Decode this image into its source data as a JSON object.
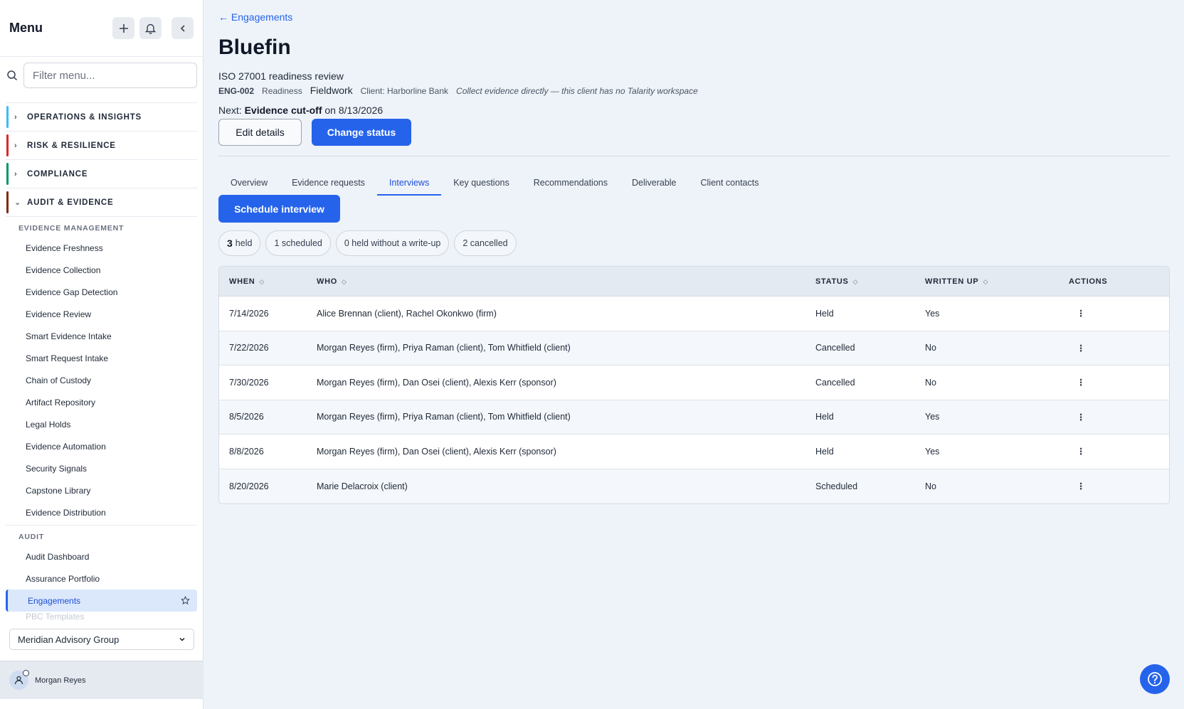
{
  "sidebar": {
    "title": "Menu",
    "filter_placeholder": "Filter menu...",
    "groups": [
      {
        "label": "OPERATIONS & INSIGHTS",
        "color": "#38bdf8"
      },
      {
        "label": "RISK & RESILIENCE",
        "color": "#dc2626"
      },
      {
        "label": "COMPLIANCE",
        "color": "#059669"
      },
      {
        "label": "AUDIT & EVIDENCE",
        "color": "#7c2d12"
      }
    ],
    "evidence_management": {
      "heading": "EVIDENCE MANAGEMENT",
      "items": [
        "Evidence Freshness",
        "Evidence Collection",
        "Evidence Gap Detection",
        "Evidence Review",
        "Smart Evidence Intake",
        "Smart Request Intake",
        "Chain of Custody",
        "Artifact Repository",
        "Legal Holds",
        "Evidence Automation",
        "Security Signals",
        "Capstone Library",
        "Evidence Distribution"
      ]
    },
    "audit": {
      "heading": "AUDIT",
      "items": [
        "Audit Dashboard",
        "Assurance Portfolio"
      ],
      "active_item": "Engagements",
      "faded_item": "PBC Templates"
    },
    "org_select": "Meridian Advisory Group",
    "user_name": "Morgan Reyes"
  },
  "engagement": {
    "back_link": "← Engagements",
    "title": "Bluefin",
    "subtitle": "ISO 27001 readiness review",
    "code": "ENG-002",
    "phase": "Readiness",
    "status": "Fieldwork",
    "client": "Client: Harborline Bank",
    "note": "Collect evidence directly — this client has no Talarity workspace",
    "next_prefix": "Next:",
    "next_event": "Evidence cut-off",
    "next_suffix": "on 8/13/2026",
    "edit_label": "Edit details",
    "change_status_label": "Change status"
  },
  "tabs": [
    "Overview",
    "Evidence requests",
    "Interviews",
    "Key questions",
    "Recommendations",
    "Deliverable",
    "Client contacts"
  ],
  "active_tab": "Interviews",
  "schedule_label": "Schedule interview",
  "chips": {
    "held_count": "3",
    "held_label": "held",
    "scheduled": "1 scheduled",
    "no_writeup": "0 held without a write-up",
    "cancelled": "2 cancelled"
  },
  "table": {
    "headers": {
      "when": "WHEN",
      "who": "WHO",
      "status": "STATUS",
      "written_up": "WRITTEN UP",
      "actions": "ACTIONS"
    },
    "rows": [
      {
        "when": "7/14/2026",
        "who": "Alice Brennan (client), Rachel Okonkwo (firm)",
        "status": "Held",
        "written_up": "Yes"
      },
      {
        "when": "7/22/2026",
        "who": "Morgan Reyes (firm), Priya Raman (client), Tom Whitfield (client)",
        "status": "Cancelled",
        "written_up": "No"
      },
      {
        "when": "7/30/2026",
        "who": "Morgan Reyes (firm), Dan Osei (client), Alexis Kerr (sponsor)",
        "status": "Cancelled",
        "written_up": "No"
      },
      {
        "when": "8/5/2026",
        "who": "Morgan Reyes (firm), Priya Raman (client), Tom Whitfield (client)",
        "status": "Held",
        "written_up": "Yes"
      },
      {
        "when": "8/8/2026",
        "who": "Morgan Reyes (firm), Dan Osei (client), Alexis Kerr (sponsor)",
        "status": "Held",
        "written_up": "Yes"
      },
      {
        "when": "8/20/2026",
        "who": "Marie Delacroix (client)",
        "status": "Scheduled",
        "written_up": "No"
      }
    ]
  },
  "colors": {
    "accent": "#2563eb",
    "sidebar_bg": "#ffffff",
    "page_bg": "#eef3f9"
  }
}
